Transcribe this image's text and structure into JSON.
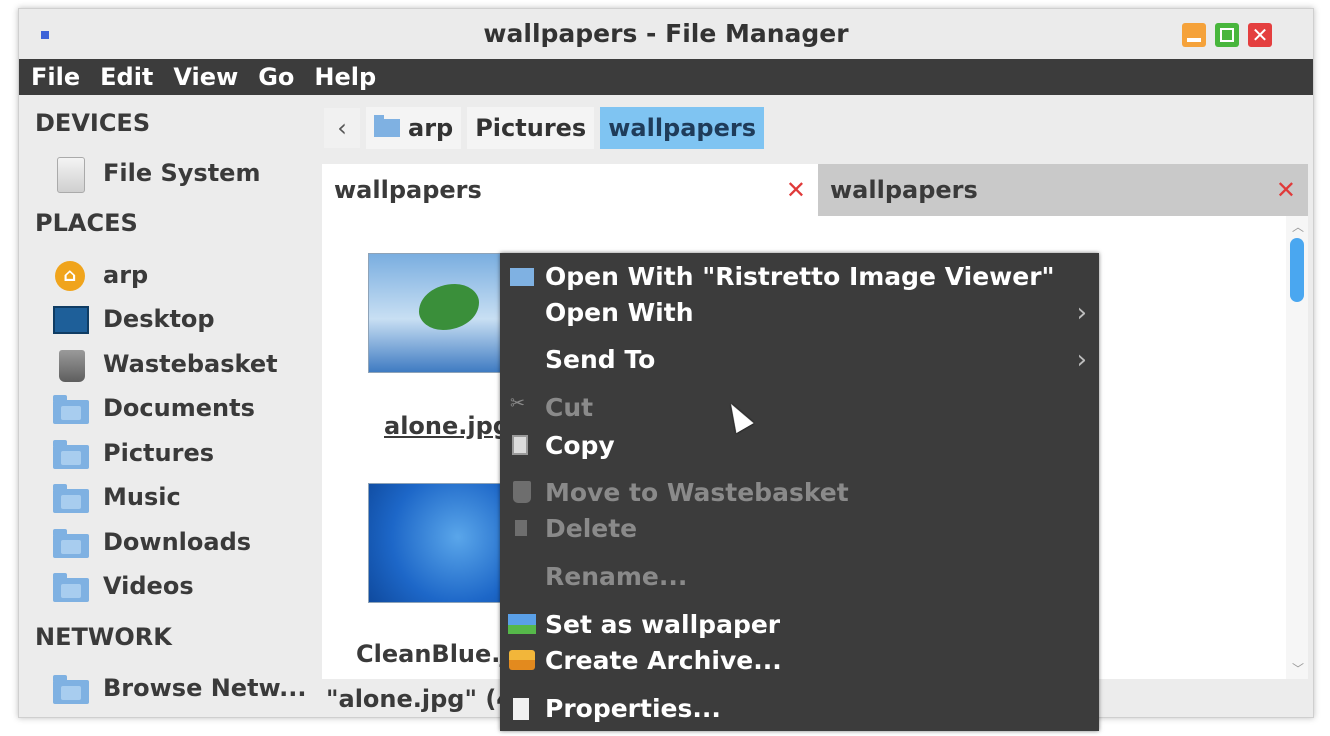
{
  "window": {
    "title": "wallpapers - File Manager"
  },
  "menubar": [
    "File",
    "Edit",
    "View",
    "Go",
    "Help"
  ],
  "sidebar": {
    "devices_heading": "DEVICES",
    "devices": [
      {
        "label": "File System",
        "icon": "drive-icon"
      }
    ],
    "places_heading": "PLACES",
    "places": [
      {
        "label": "arp",
        "icon": "home-icon"
      },
      {
        "label": "Desktop",
        "icon": "desktop-icon"
      },
      {
        "label": "Wastebasket",
        "icon": "wastebasket-icon"
      },
      {
        "label": "Documents",
        "icon": "folder-icon"
      },
      {
        "label": "Pictures",
        "icon": "folder-icon"
      },
      {
        "label": "Music",
        "icon": "folder-icon"
      },
      {
        "label": "Downloads",
        "icon": "folder-icon"
      },
      {
        "label": "Videos",
        "icon": "folder-icon"
      }
    ],
    "network_heading": "NETWORK",
    "network": [
      {
        "label": "Browse Netw...",
        "icon": "network-folder-icon"
      }
    ]
  },
  "pathbar": {
    "back": "‹",
    "segments": [
      "arp",
      "Pictures",
      "wallpapers"
    ]
  },
  "tabs": [
    {
      "label": "wallpapers",
      "close": "✕"
    },
    {
      "label": "wallpapers",
      "close": "✕"
    }
  ],
  "files": [
    {
      "name": "alone.jpg"
    },
    {
      "name": "CleanBlue.jpg"
    }
  ],
  "statusbar": {
    "text": "\"alone.jpg\" (4"
  },
  "context_menu": {
    "items": [
      {
        "label": "Open With \"Ristretto Image Viewer\"",
        "icon": "folder-icon",
        "enabled": true
      },
      {
        "label": "Open With",
        "submenu": true,
        "enabled": true
      },
      {
        "label": "Send To",
        "submenu": true,
        "enabled": true
      },
      {
        "label": "Cut",
        "icon": "scissors-icon",
        "enabled": false
      },
      {
        "label": "Copy",
        "icon": "copy-icon",
        "enabled": true
      },
      {
        "label": "Move to Wastebasket",
        "icon": "trash-icon",
        "enabled": false
      },
      {
        "label": "Delete",
        "icon": "delete-icon",
        "enabled": false
      },
      {
        "label": "Rename...",
        "enabled": false
      },
      {
        "label": "Set as wallpaper",
        "icon": "wallpaper-icon",
        "enabled": true
      },
      {
        "label": "Create Archive...",
        "icon": "archive-icon",
        "enabled": true
      },
      {
        "label": "Properties...",
        "icon": "properties-icon",
        "enabled": true
      }
    ]
  },
  "colors": {
    "menubar_bg": "#3c3c3c",
    "selection": "#7fc4f2",
    "tab_close": "#e03a3a",
    "scrollbar_thumb": "#4aa7f0"
  }
}
